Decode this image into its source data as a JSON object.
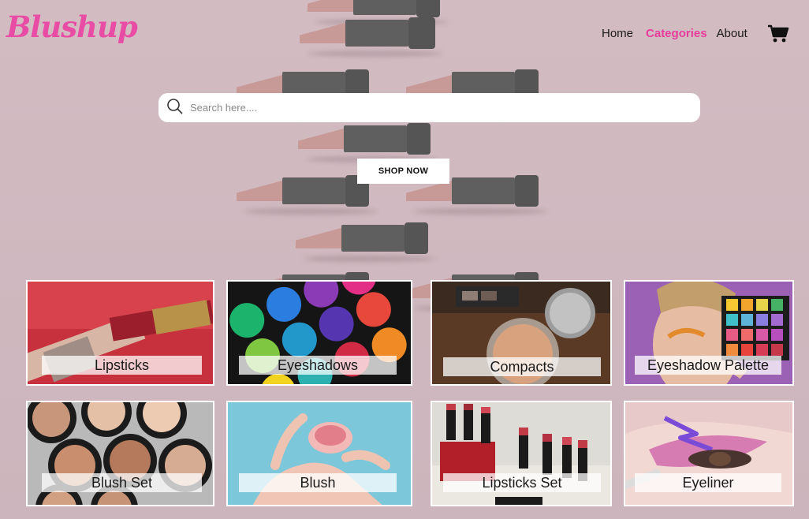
{
  "brand": {
    "name": "Blushup"
  },
  "nav": {
    "items": [
      {
        "label": "Home",
        "active": false
      },
      {
        "label": "Categories",
        "active": true
      },
      {
        "label": "About",
        "active": false
      }
    ],
    "cart_icon": "shopping-cart-icon"
  },
  "search": {
    "placeholder": "Search here....",
    "icon": "search-icon"
  },
  "hero": {
    "cta_label": "SHOP NOW"
  },
  "categories": [
    {
      "label": "Lipsticks"
    },
    {
      "label": "Eyeshadows"
    },
    {
      "label": "Compacts"
    },
    {
      "label": "Eyeshadow Palette"
    },
    {
      "label": "Blush Set"
    },
    {
      "label": "Blush"
    },
    {
      "label": "Lipsticks Set"
    },
    {
      "label": "Eyeliner"
    }
  ],
  "colors": {
    "brand_pink": "#e84ca4",
    "active_nav": "#e83c9c",
    "background": "#d2bcc2"
  }
}
